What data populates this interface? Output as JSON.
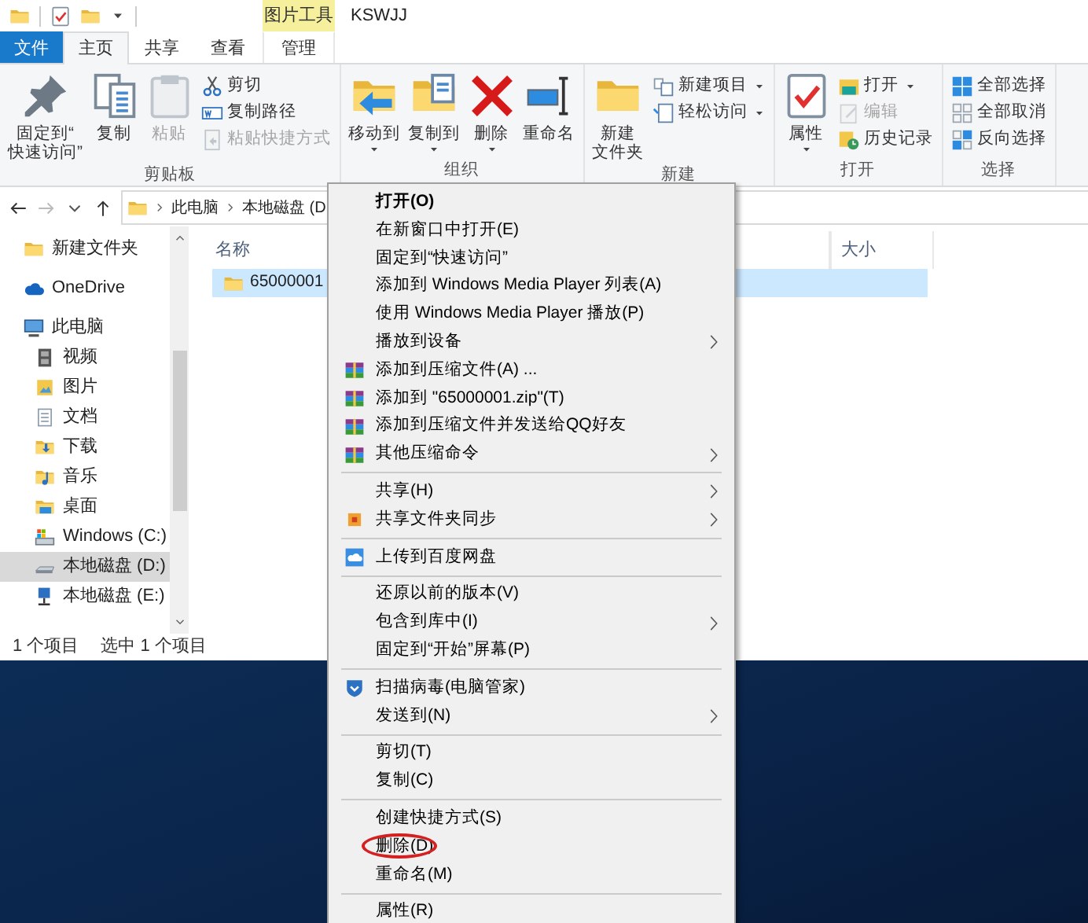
{
  "window": {
    "title": "KSWJJ",
    "contextual_tab_group": "图片工具"
  },
  "ribbon_tabs": [
    {
      "label": "文件",
      "kind": "file",
      "selected": false
    },
    {
      "label": "主页",
      "kind": "tab",
      "selected": true
    },
    {
      "label": "共享",
      "kind": "tab",
      "selected": false
    },
    {
      "label": "查看",
      "kind": "tab",
      "selected": false
    },
    {
      "label": "管理",
      "kind": "contextual",
      "selected": false
    }
  ],
  "ribbon_groups": [
    {
      "label": "剪贴板",
      "commands": [
        {
          "kind": "pin",
          "lines": [
            "固定到“",
            "快速访问”"
          ],
          "large": true,
          "dropdown": false,
          "disabled": false
        },
        {
          "kind": "copy",
          "lines": [
            "复制"
          ],
          "large": true,
          "dropdown": false,
          "disabled": false
        },
        {
          "kind": "paste",
          "lines": [
            "粘贴"
          ],
          "large": true,
          "dropdown": false,
          "disabled": true
        },
        {
          "kind": "cut",
          "lines": [
            "剪切"
          ],
          "large": false,
          "dropdown": false,
          "disabled": false
        },
        {
          "kind": "copy-path",
          "lines": [
            "复制路径"
          ],
          "large": false,
          "dropdown": false,
          "disabled": false
        },
        {
          "kind": "paste-shortcut",
          "lines": [
            "粘贴快捷方式"
          ],
          "large": false,
          "dropdown": false,
          "disabled": true
        }
      ]
    },
    {
      "label": "组织",
      "commands": [
        {
          "kind": "move-to",
          "lines": [
            "移动到"
          ],
          "large": true,
          "dropdown": true,
          "disabled": false
        },
        {
          "kind": "copy-to",
          "lines": [
            "复制到"
          ],
          "large": true,
          "dropdown": true,
          "disabled": false
        },
        {
          "kind": "delete",
          "lines": [
            "删除"
          ],
          "large": true,
          "dropdown": true,
          "disabled": false
        },
        {
          "kind": "rename",
          "lines": [
            "重命名"
          ],
          "large": true,
          "dropdown": false,
          "disabled": false
        }
      ]
    },
    {
      "label": "新建",
      "commands": [
        {
          "kind": "new-folder",
          "lines": [
            "新建",
            "文件夹"
          ],
          "large": true,
          "dropdown": false,
          "disabled": false
        },
        {
          "kind": "new-item",
          "lines": [
            "新建项目"
          ],
          "large": false,
          "dropdown": true,
          "disabled": false
        },
        {
          "kind": "easy-access",
          "lines": [
            "轻松访问"
          ],
          "large": false,
          "dropdown": true,
          "disabled": false
        }
      ]
    },
    {
      "label": "打开",
      "commands": [
        {
          "kind": "properties",
          "lines": [
            "属性"
          ],
          "large": true,
          "dropdown": true,
          "disabled": false
        },
        {
          "kind": "open",
          "lines": [
            "打开"
          ],
          "large": false,
          "dropdown": true,
          "disabled": false
        },
        {
          "kind": "edit",
          "lines": [
            "编辑"
          ],
          "large": false,
          "dropdown": false,
          "disabled": true
        },
        {
          "kind": "history",
          "lines": [
            "历史记录"
          ],
          "large": false,
          "dropdown": false,
          "disabled": false
        }
      ]
    },
    {
      "label": "选择",
      "commands": [
        {
          "kind": "select-all",
          "lines": [
            "全部选择"
          ],
          "large": false,
          "dropdown": false,
          "disabled": false
        },
        {
          "kind": "select-none",
          "lines": [
            "全部取消"
          ],
          "large": false,
          "dropdown": false,
          "disabled": false
        },
        {
          "kind": "invert",
          "lines": [
            "反向选择"
          ],
          "large": false,
          "dropdown": false,
          "disabled": false
        }
      ]
    }
  ],
  "address_bar": {
    "path": [
      "此电脑",
      "本地磁盘 (D"
    ]
  },
  "navigation_pane": {
    "items": [
      {
        "kind": "folder",
        "label": "新建文件夹",
        "selected": false
      },
      {
        "kind": "onedrive",
        "label": "OneDrive",
        "selected": false
      },
      {
        "kind": "pc",
        "label": "此电脑",
        "selected": false,
        "children": [
          {
            "kind": "video",
            "label": "视频",
            "selected": false
          },
          {
            "kind": "pictures",
            "label": "图片",
            "selected": false
          },
          {
            "kind": "documents",
            "label": "文档",
            "selected": false
          },
          {
            "kind": "downloads",
            "label": "下载",
            "selected": false
          },
          {
            "kind": "music",
            "label": "音乐",
            "selected": false
          },
          {
            "kind": "desktop",
            "label": "桌面",
            "selected": false
          },
          {
            "kind": "system-drive",
            "label": "Windows (C:)",
            "selected": false
          },
          {
            "kind": "drive",
            "label": "本地磁盘 (D:)",
            "selected": true
          },
          {
            "kind": "network-drive",
            "label": "本地磁盘 (E:)",
            "selected": false
          }
        ]
      }
    ]
  },
  "files": {
    "columns": [
      {
        "label": "名称"
      },
      {
        "label": "大小"
      }
    ],
    "rows": [
      {
        "name": "65000001",
        "selected": true
      }
    ]
  },
  "status_bar": {
    "items": [
      "1 个项目",
      "选中 1 个项目"
    ]
  },
  "context_menu": {
    "items": [
      {
        "kind": "default",
        "label": "打开(O)",
        "submenu": false,
        "circled": false
      },
      {
        "kind": "plain",
        "label": "在新窗口中打开(E)",
        "submenu": false,
        "circled": false
      },
      {
        "kind": "plain",
        "label": "固定到“快速访问”",
        "submenu": false,
        "circled": false
      },
      {
        "kind": "plain",
        "label": "添加到 Windows Media Player 列表(A)",
        "submenu": false,
        "circled": false
      },
      {
        "kind": "plain",
        "label": "使用 Windows Media Player 播放(P)",
        "submenu": false,
        "circled": false
      },
      {
        "kind": "plain",
        "label": "播放到设备",
        "submenu": true,
        "circled": false
      },
      {
        "kind": "archive",
        "label": "添加到压缩文件(A) ...",
        "submenu": false,
        "circled": false
      },
      {
        "kind": "archive",
        "label": "添加到 \"65000001.zip\"(T)",
        "submenu": false,
        "circled": false
      },
      {
        "kind": "archive",
        "label": "添加到压缩文件并发送给QQ好友",
        "submenu": false,
        "circled": false
      },
      {
        "kind": "archive",
        "label": "其他压缩命令",
        "submenu": true,
        "circled": false
      },
      {
        "kind": "separator"
      },
      {
        "kind": "plain",
        "label": "共享(H)",
        "submenu": true,
        "circled": false
      },
      {
        "kind": "sync",
        "label": "共享文件夹同步",
        "submenu": true,
        "circled": false
      },
      {
        "kind": "separator"
      },
      {
        "kind": "cloud",
        "label": "上传到百度网盘",
        "submenu": false,
        "circled": false
      },
      {
        "kind": "separator"
      },
      {
        "kind": "plain",
        "label": "还原以前的版本(V)",
        "submenu": false,
        "circled": false
      },
      {
        "kind": "plain",
        "label": "包含到库中(I)",
        "submenu": true,
        "circled": false
      },
      {
        "kind": "plain",
        "label": "固定到“开始”屏幕(P)",
        "submenu": false,
        "circled": false
      },
      {
        "kind": "separator"
      },
      {
        "kind": "shield",
        "label": "扫描病毒(电脑管家)",
        "submenu": false,
        "circled": false
      },
      {
        "kind": "plain",
        "label": "发送到(N)",
        "submenu": true,
        "circled": false
      },
      {
        "kind": "separator"
      },
      {
        "kind": "plain",
        "label": "剪切(T)",
        "submenu": false,
        "circled": false
      },
      {
        "kind": "plain",
        "label": "复制(C)",
        "submenu": false,
        "circled": false
      },
      {
        "kind": "separator"
      },
      {
        "kind": "plain",
        "label": "创建快捷方式(S)",
        "submenu": false,
        "circled": false
      },
      {
        "kind": "plain",
        "label": "删除(D)",
        "submenu": false,
        "circled": true
      },
      {
        "kind": "plain",
        "label": "重命名(M)",
        "submenu": false,
        "circled": false
      },
      {
        "kind": "separator"
      },
      {
        "kind": "plain",
        "label": "属性(R)",
        "submenu": false,
        "circled": false
      }
    ]
  }
}
